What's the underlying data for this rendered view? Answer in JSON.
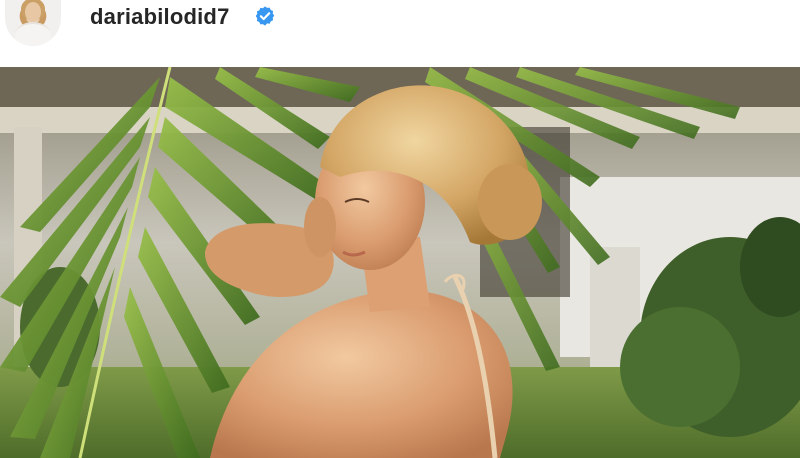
{
  "header": {
    "username": "dariabilodid7",
    "avatar_icon": "profile-avatar",
    "verified_icon": "verified-badge-icon",
    "verified_color": "#3897f0"
  },
  "post": {
    "image_icon": "post-photo"
  }
}
